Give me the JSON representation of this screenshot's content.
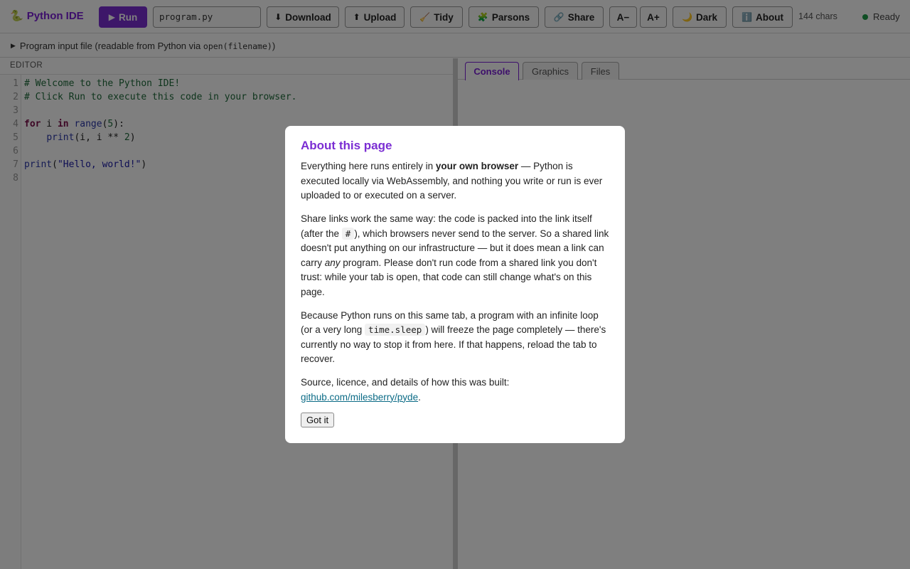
{
  "app": {
    "title": "Python IDE",
    "logo_icon": "snake-icon",
    "brand_color": "#7b1fd6"
  },
  "toolbar": {
    "run_label": "Run",
    "filename_value": "program.py",
    "download_label": "Download",
    "upload_label": "Upload",
    "tidy_label": "Tidy",
    "parsons_label": "Parsons",
    "share_label": "Share",
    "font_smaller_label": "A−",
    "font_larger_label": "A+",
    "dark_label": "Dark",
    "about_label": "About",
    "char_count": "144 chars",
    "status": "Ready"
  },
  "input_file": {
    "label_prefix": "Program input file (readable from Python via ",
    "label_code": "open(filename)",
    "label_suffix": ")"
  },
  "editor": {
    "label": "EDITOR",
    "line_numbers": [
      "1",
      "2",
      "3",
      "4",
      "5",
      "6",
      "7",
      "8"
    ],
    "lines": [
      "# Welcome to the Python IDE!",
      "# Click Run to execute this code in your browser.",
      "",
      "for i in range(5):",
      "    print(i, i ** 2)",
      "",
      "print(\"Hello, world!\")",
      ""
    ]
  },
  "output_tabs": {
    "console": "Console",
    "graphics": "Graphics",
    "files": "Files",
    "active": "Console"
  },
  "about_modal": {
    "title": "About this page",
    "p1_a": "Everything here runs entirely in ",
    "p1_bold": "your own browser",
    "p1_b": " — Python is executed locally via WebAssembly, and nothing you write or run is ever uploaded to or executed on a server.",
    "p2_a": "Share links work the same way: the code is packed into the link itself (after the ",
    "p2_code": "#",
    "p2_b": "), which browsers never send to the server. So a shared link doesn't put anything on our infrastructure — but it does mean a link can carry ",
    "p2_em": "any",
    "p2_c": " program. Please don't run code from a shared link you don't trust: while your tab is open, that code can still change what's on this page.",
    "p3_a": "Because Python runs on this same tab, a program with an infinite loop (or a very long ",
    "p3_code": "time.sleep",
    "p3_b": ") will freeze the page completely — there's currently no way to stop it from here. If that happens, reload the tab to recover.",
    "p4_a": "Source, licence, and details of how this was built:",
    "p4_link": "github.com/milesberry/pyde",
    "p4_b": ".",
    "button": "Got it"
  }
}
